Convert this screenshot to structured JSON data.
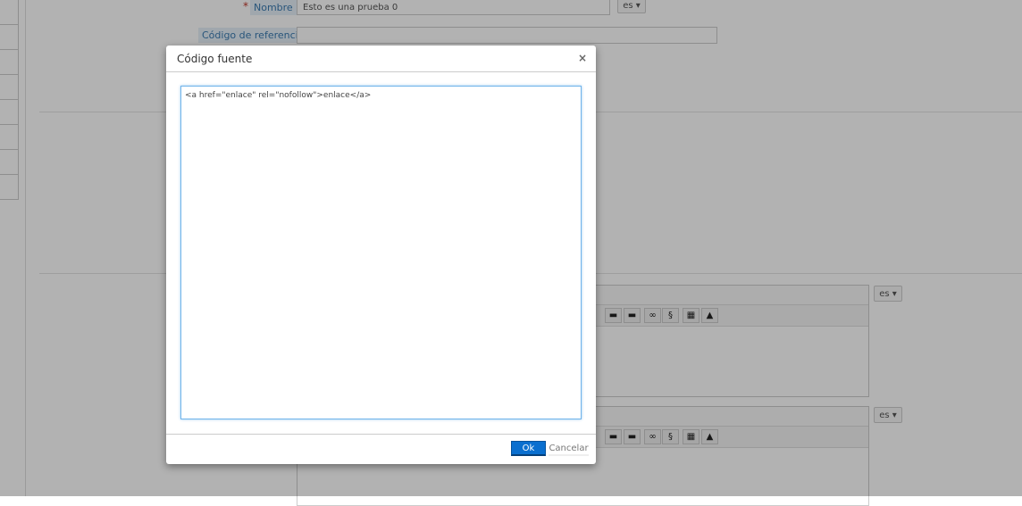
{
  "form": {
    "name_label": "Nombre",
    "required_mark": "*",
    "name_value": "Esto es una prueba 0",
    "ref_label": "Código de referencia",
    "ref_value": "",
    "lang": "es ▾"
  },
  "editors": [
    {
      "lang": "es ▾"
    },
    {
      "lang": "es ▾"
    }
  ],
  "modal": {
    "title": "Código fuente",
    "close": "×",
    "source": "<a href=\"enlace\" rel=\"nofollow\">enlace</a>",
    "ok": "Ok",
    "cancel": "Cancelar"
  }
}
